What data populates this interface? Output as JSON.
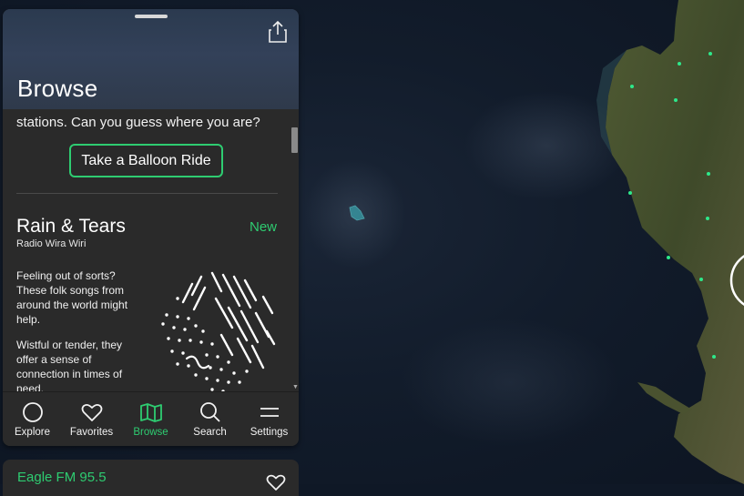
{
  "panel": {
    "title": "Browse",
    "intro_text": "stations. Can you guess where you are?",
    "balloon_button": "Take a Balloon Ride"
  },
  "card": {
    "title": "Rain & Tears",
    "badge": "New",
    "station": "Radio Wira Wiri",
    "paragraph1": "Feeling out of sorts? These folk songs from around the world might help.",
    "paragraph2": "Wistful or tender, they offer a sense of connection in times of need.",
    "art_icon": "rain-tears-art"
  },
  "tabs": [
    {
      "label": "Explore",
      "icon": "circle-icon"
    },
    {
      "label": "Favorites",
      "icon": "heart-icon"
    },
    {
      "label": "Browse",
      "icon": "map-icon",
      "active": true
    },
    {
      "label": "Search",
      "icon": "search-icon"
    },
    {
      "label": "Settings",
      "icon": "menu-icon"
    }
  ],
  "now_playing": {
    "title": "Eagle FM 95.5"
  },
  "colors": {
    "accent": "#2ecc71",
    "panel": "#2a2a2a",
    "station_dot": "#2ee88a"
  }
}
